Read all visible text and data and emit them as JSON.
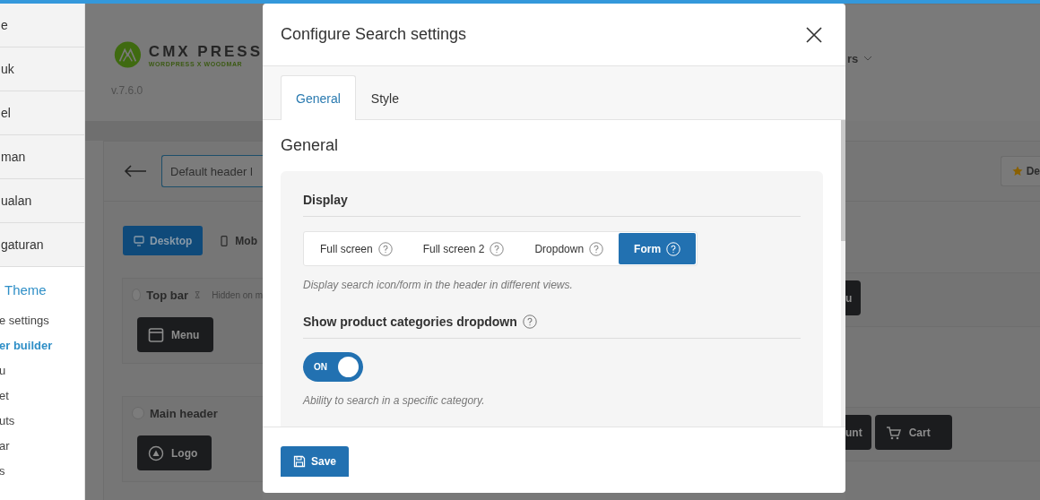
{
  "sidebar": {
    "menu_items": [
      {
        "label": "e"
      },
      {
        "label": "uk"
      },
      {
        "label": "el"
      },
      {
        "label": "man"
      },
      {
        "label": "ualan"
      },
      {
        "label": "gaturan"
      }
    ],
    "submenu": {
      "title": "Theme",
      "items": [
        {
          "label": "e settings",
          "selected": false
        },
        {
          "label": "er builder",
          "selected": true
        },
        {
          "label": "u",
          "selected": false
        },
        {
          "label": "et",
          "selected": false
        },
        {
          "label": "uts",
          "selected": false
        },
        {
          "label": "ar",
          "selected": false
        },
        {
          "label": "s",
          "selected": false
        }
      ]
    }
  },
  "background": {
    "logo": {
      "name": "CMX PRESS",
      "tagline": "WORDPRESS X WOODMAR"
    },
    "version": "v.7.6.0",
    "nav_item": "rs",
    "layout_name": "Default header l",
    "star_button": "De",
    "device_tabs": [
      {
        "label": "Desktop",
        "selected": true
      },
      {
        "label": "Mob",
        "selected": false
      }
    ],
    "rows": [
      {
        "title": "Top bar",
        "note": "Hidden on m",
        "left_items": [
          {
            "label": "Menu",
            "kind": "menu"
          }
        ],
        "right_items": [
          {
            "label": "u",
            "kind": "plain"
          }
        ]
      },
      {
        "title": "Main header",
        "left_items": [
          {
            "label": "Logo",
            "kind": "logo"
          }
        ],
        "right_items": [
          {
            "label": "unt",
            "kind": "plain"
          },
          {
            "label": "Cart",
            "kind": "cart"
          }
        ]
      }
    ]
  },
  "dialog": {
    "title": "Configure Search settings",
    "tabs": [
      {
        "label": "General",
        "selected": true
      },
      {
        "label": "Style",
        "selected": false
      }
    ],
    "heading": "General",
    "display": {
      "label": "Display",
      "options": [
        {
          "label": "Full screen",
          "selected": false
        },
        {
          "label": "Full screen 2",
          "selected": false
        },
        {
          "label": "Dropdown",
          "selected": false
        },
        {
          "label": "Form",
          "selected": true
        }
      ],
      "description": "Display search icon/form in the header in different views."
    },
    "categories": {
      "label": "Show product categories dropdown",
      "toggle_label": "ON",
      "on": true,
      "description": "Ability to search in a specific category."
    },
    "save_button": "Save"
  }
}
